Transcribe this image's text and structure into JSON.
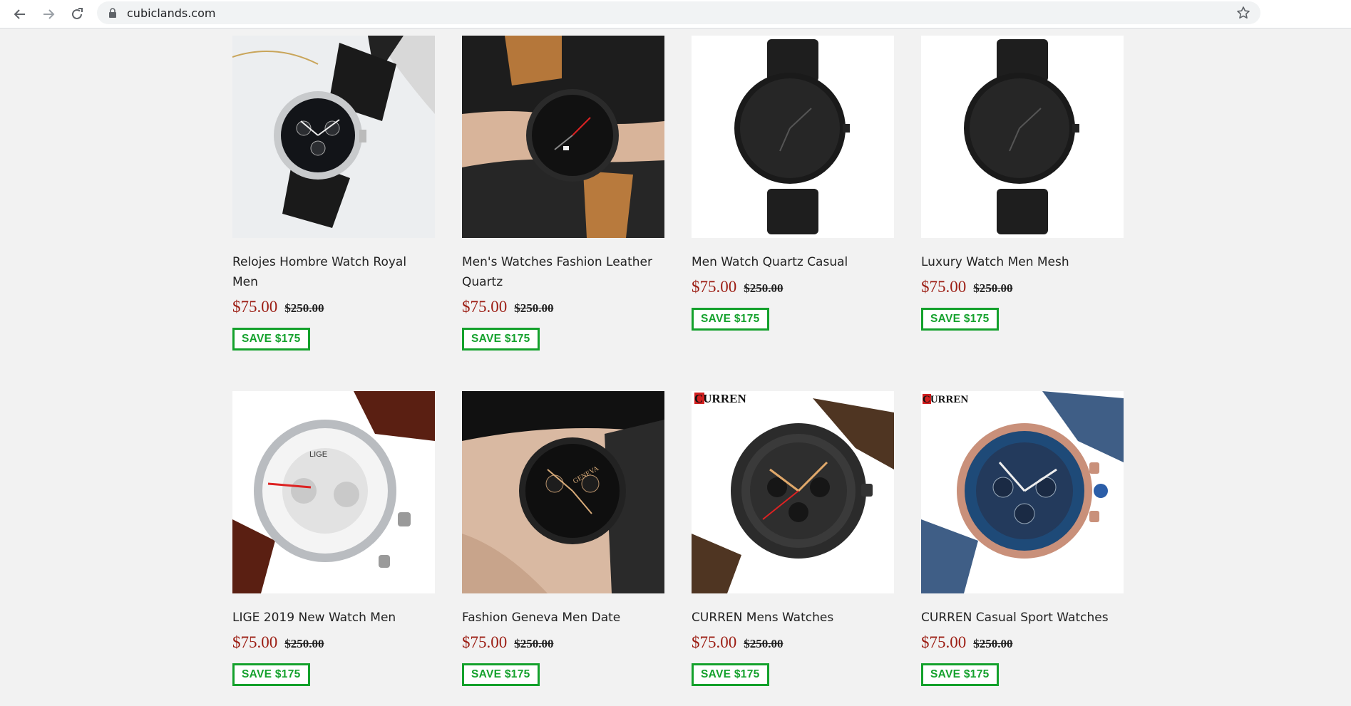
{
  "browser": {
    "url": "cubiclands.com",
    "back_icon": "arrow-left-icon",
    "forward_icon": "arrow-right-icon",
    "reload_icon": "reload-icon",
    "lock_icon": "lock-icon",
    "bookmark_icon": "star-icon"
  },
  "colors": {
    "price": "#9c1d13",
    "save_badge": "#14a12c",
    "page_background": "#f2f2f2"
  },
  "products": [
    {
      "title": "Relojes Hombre Watch Royal Men",
      "price": "$75.00",
      "compare_price": "$250.00",
      "save": "SAVE $175",
      "image": "silver chronograph with black leather strap"
    },
    {
      "title": "Men's Watches Fashion Leather Quartz",
      "price": "$75.00",
      "compare_price": "$250.00",
      "save": "SAVE $175",
      "image": "black watch with tan leather strap on wrist"
    },
    {
      "title": "Men Watch Quartz Casual",
      "price": "$75.00",
      "compare_price": "$250.00",
      "save": "SAVE $175",
      "image": "black minimalist mesh watch"
    },
    {
      "title": "Luxury Watch Men Mesh",
      "price": "$75.00",
      "compare_price": "$250.00",
      "save": "SAVE $175",
      "image": "black minimalist mesh watch"
    },
    {
      "title": "LIGE 2019 New Watch Men",
      "price": "$75.00",
      "compare_price": "$250.00",
      "save": "SAVE $175",
      "image": "silver chronograph with brown leather strap",
      "dial_text": "LIGE"
    },
    {
      "title": "Fashion Geneva Men Date",
      "price": "$75.00",
      "compare_price": "$250.00",
      "save": "SAVE $175",
      "image": "black geneva watch on wrist",
      "dial_text": "GENEVA"
    },
    {
      "title": "CURREN Mens Watches",
      "price": "$75.00",
      "compare_price": "$250.00",
      "save": "SAVE $175",
      "image": "curren black chronograph brown strap",
      "logo_text": "CURREN"
    },
    {
      "title": "CURREN Casual Sport Watches",
      "price": "$75.00",
      "compare_price": "$250.00",
      "save": "SAVE $175",
      "image": "curren blue rose-gold chronograph",
      "logo_text": "CURREN"
    }
  ]
}
